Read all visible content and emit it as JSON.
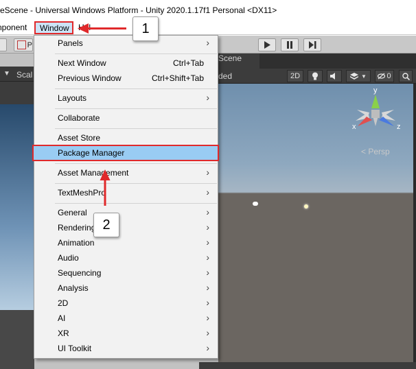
{
  "window": {
    "title": "eScene - Universal Windows Platform - Unity 2020.1.17f1 Personal <DX11>"
  },
  "menubar": {
    "items": [
      "nponent",
      "Window",
      "Hel"
    ]
  },
  "toolbar": {
    "left_partial": "P",
    "play_icon": "play-icon",
    "pause_icon": "pause-icon",
    "step_icon": "step-icon"
  },
  "left_panel": {
    "scale_label": "Scal"
  },
  "scene": {
    "tab_label": "Scene",
    "shading_mode": "ded",
    "toggle_2d": "2D",
    "visibility_count": "0",
    "projection": "< Persp",
    "gizmo_axes": {
      "y": "y",
      "x": "x",
      "z": "z"
    }
  },
  "window_menu": {
    "items": [
      {
        "label": "Panels",
        "shortcut": "",
        "submenu": true
      },
      {
        "label": "Next Window",
        "shortcut": "Ctrl+Tab",
        "submenu": false
      },
      {
        "label": "Previous Window",
        "shortcut": "Ctrl+Shift+Tab",
        "submenu": false
      },
      {
        "label": "Layouts",
        "shortcut": "",
        "submenu": true
      },
      {
        "label": "Collaborate",
        "shortcut": "",
        "submenu": false
      },
      {
        "label": "Asset Store",
        "shortcut": "",
        "submenu": false
      },
      {
        "label": "Package Manager",
        "shortcut": "",
        "submenu": false
      },
      {
        "label": "Asset Management",
        "shortcut": "",
        "submenu": true
      },
      {
        "label": "TextMeshPro",
        "shortcut": "",
        "submenu": true
      },
      {
        "label": "General",
        "shortcut": "",
        "submenu": true
      },
      {
        "label": "Rendering",
        "shortcut": "",
        "submenu": true
      },
      {
        "label": "Animation",
        "shortcut": "",
        "submenu": true
      },
      {
        "label": "Audio",
        "shortcut": "",
        "submenu": true
      },
      {
        "label": "Sequencing",
        "shortcut": "",
        "submenu": true
      },
      {
        "label": "Analysis",
        "shortcut": "",
        "submenu": true
      },
      {
        "label": "2D",
        "shortcut": "",
        "submenu": true
      },
      {
        "label": "AI",
        "shortcut": "",
        "submenu": true
      },
      {
        "label": "XR",
        "shortcut": "",
        "submenu": true
      },
      {
        "label": "UI Toolkit",
        "shortcut": "",
        "submenu": true
      }
    ],
    "submenu_glyph": "›",
    "highlighted": "Package Manager"
  },
  "annotations": {
    "step1": "1",
    "step2": "2",
    "highlight_color": "#e0292b"
  }
}
